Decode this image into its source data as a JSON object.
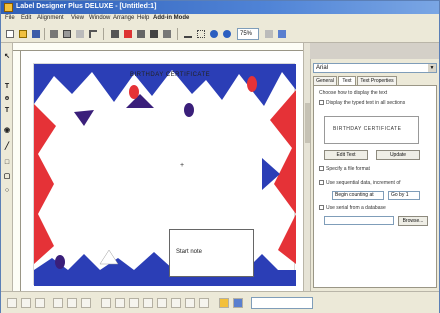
{
  "window": {
    "title": "Label Designer Plus DELUXE - [Untitled:1]"
  },
  "menu": [
    "File",
    "Edit",
    "Alignment",
    "View",
    "Window",
    "Arrange",
    "Help",
    "Add-in Mode"
  ],
  "toolbar": {
    "zoom_value": "75%"
  },
  "canvas": {
    "header_text": "BIRTHDAY CERTIFICATE",
    "start_popup": "Start note",
    "cursor_symbol": "+"
  },
  "right_panel": {
    "font_combo": "Arial",
    "tabs": [
      "General",
      "Text",
      "Text Properties"
    ],
    "lines": {
      "l1": "Choose how to display the text",
      "l2": "Display the typed text in all sections",
      "preview_text": "BIRTHDAY CERTIFICATE",
      "btn_edit": "Edit Text",
      "btn_update": "Update",
      "l3": "Specify a file format",
      "l4": "Use sequential data, increment of",
      "field_start": "Begin counting at",
      "field_step": "Go by 1",
      "l5": "Use serial from a database",
      "btn_browse": "Browse..."
    }
  },
  "colors": {
    "navy": "#2b3eb6",
    "red": "#e53237",
    "purple": "#3a1f7a",
    "chrome": "#ece9d8",
    "title_blue": "#2f5fb8"
  }
}
